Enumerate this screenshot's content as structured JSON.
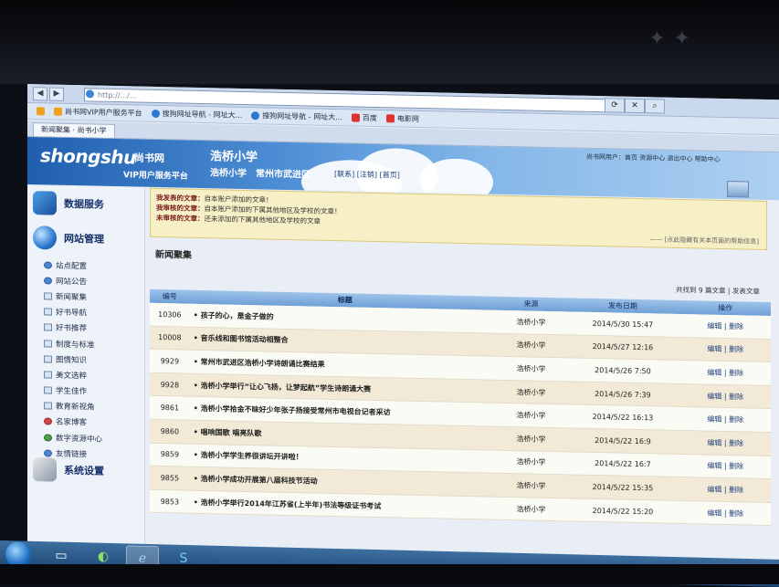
{
  "browser": {
    "address": "http://.../...",
    "favorites": [
      {
        "label": "尚书网VIP用户服务平台"
      },
      {
        "label": "搜狗网址导航 - 网址大..."
      },
      {
        "label": "搜狗网址导航 - 网址大..."
      },
      {
        "label": "百度"
      },
      {
        "label": "电影网"
      }
    ],
    "tab_label": "新闻聚集 · 尚书小学"
  },
  "header": {
    "logo": "shongshu",
    "logo_cn": "尚书网",
    "logo_sub": "VIP用户服务平台",
    "school_title": "浩桥小学",
    "school_name": "浩桥小学",
    "district": "常州市武进区",
    "links": "[联系] [注销] [首页]",
    "user_info": "尚书网用户：首页 资源中心 退出中心 帮助中心"
  },
  "sidebar": {
    "sections": [
      {
        "label": "数据服务"
      },
      {
        "label": "网站管理"
      },
      {
        "label": "系统设置"
      }
    ],
    "items": [
      {
        "label": "站点配置"
      },
      {
        "label": "网站公告"
      },
      {
        "label": "新闻聚集"
      },
      {
        "label": "好书导航"
      },
      {
        "label": "好书推荐"
      },
      {
        "label": "制度与标准"
      },
      {
        "label": "图情知识"
      },
      {
        "label": "美文选粹"
      },
      {
        "label": "学生佳作"
      },
      {
        "label": "教育新视角"
      },
      {
        "label": "名家博客"
      },
      {
        "label": "数字资源中心"
      },
      {
        "label": "友情链接"
      }
    ]
  },
  "notice": {
    "lines": [
      {
        "label": "我发表的文章：",
        "text": "自本账户添加的文章！"
      },
      {
        "label": "我审核的文章：",
        "text": "自本账户添加的下属其他地区及学校的文章！"
      },
      {
        "label": "未审核的文章：",
        "text": "还未添加的下属其他地区及学校的文章"
      }
    ],
    "tip": "—— [点此隐藏有关本页面的帮助信息]"
  },
  "main": {
    "title": "新闻聚集",
    "summary": "共找到 9 篇文章 | 发表文章"
  },
  "table": {
    "headers": {
      "id": "编号",
      "title": "标题",
      "source": "来源",
      "date": "发布日期",
      "ops": "操作"
    },
    "rows": [
      {
        "id": "10306",
        "title": "• 孩子的心，是金子做的",
        "source": "浩桥小学",
        "date": "2014/5/30 15:47",
        "ops": "编辑 | 删除"
      },
      {
        "id": "10008",
        "title": "• 音乐线和图书馆活动相整合",
        "source": "浩桥小学",
        "date": "2014/5/27 12:16",
        "ops": "编辑 | 删除"
      },
      {
        "id": "9929",
        "title": "• 常州市武进区浩桥小学诗朗诵比赛结果",
        "source": "浩桥小学",
        "date": "2014/5/26 7:50",
        "ops": "编辑 | 删除"
      },
      {
        "id": "9928",
        "title": "• 浩桥小学举行“让心飞扬，让梦起航”学生诗朗诵大赛",
        "source": "浩桥小学",
        "date": "2014/5/26 7:39",
        "ops": "编辑 | 删除"
      },
      {
        "id": "9861",
        "title": "• 浩桥小学拾金不昧好少年张子扬接受常州市电视台记者采访",
        "source": "浩桥小学",
        "date": "2014/5/22 16:13",
        "ops": "编辑 | 删除"
      },
      {
        "id": "9860",
        "title": "• 唱响国歌 唱亮队歌",
        "source": "浩桥小学",
        "date": "2014/5/22 16:9",
        "ops": "编辑 | 删除"
      },
      {
        "id": "9859",
        "title": "• 浩桥小学学生养很讲坛开讲啦！",
        "source": "浩桥小学",
        "date": "2014/5/22 16:7",
        "ops": "编辑 | 删除"
      },
      {
        "id": "9855",
        "title": "• 浩桥小学成功开展第八届科技节活动",
        "source": "浩桥小学",
        "date": "2014/5/22 15:35",
        "ops": "编辑 | 删除"
      },
      {
        "id": "9853",
        "title": "• 浩桥小学举行2014年江苏省(上半年)书法等级证书考试",
        "source": "浩桥小学",
        "date": "2014/5/22 15:20",
        "ops": "编辑 | 删除"
      }
    ]
  },
  "colors": {
    "header_blue": "#1f5fae",
    "notice_bg": "#f7f0c6",
    "table_head": "#6fa0d6",
    "row_alt": "#f2ead7"
  },
  "icons": {
    "data_service": "cube-icon",
    "site_manage": "globe-icon",
    "system_settings": "tools-icon",
    "start": "windows-start-icon"
  }
}
